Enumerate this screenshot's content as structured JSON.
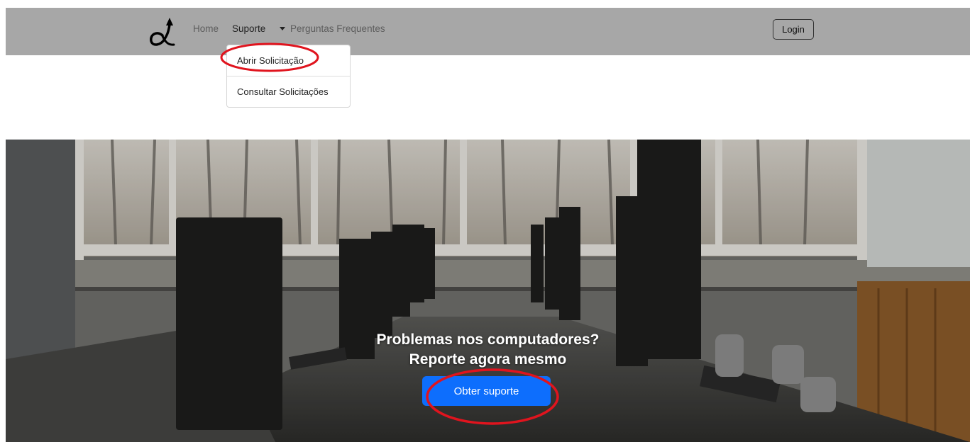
{
  "navbar": {
    "logo_icon": "alpha-logo-icon",
    "links": [
      {
        "label": "Home"
      },
      {
        "label": "Suporte"
      },
      {
        "label": "Perguntas Frequentes"
      }
    ],
    "login_label": "Login",
    "background": "#a7a7a7"
  },
  "dropdown": {
    "items": [
      {
        "label": "Abrir Solicitação"
      },
      {
        "label": "Consultar Solicitações"
      }
    ]
  },
  "hero": {
    "title_line1": "Problemas nos computadores?",
    "title_line2": "Reporte agora mesmo",
    "cta_label": "Obter suporte",
    "cta_color": "#0d6efd"
  },
  "annotations": {
    "highlight_color": "#e0141e"
  }
}
